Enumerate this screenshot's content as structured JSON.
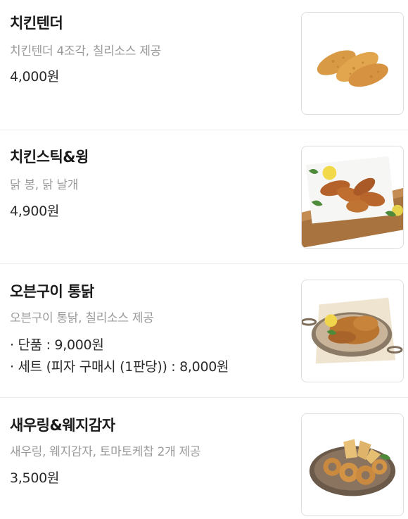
{
  "menu": {
    "items": [
      {
        "name": "치킨텐더",
        "description": "치킨텐더 4조각, 칠리소스 제공",
        "price": "4,000원",
        "image": "chicken-tenders-photo"
      },
      {
        "name": "치킨스틱&윙",
        "description": "닭 봉, 닭 날개",
        "price": "4,900원",
        "image": "chicken-sticks-wings-photo"
      },
      {
        "name": "오븐구이 통닭",
        "description": "오븐구이 통닭, 칠리소스 제공",
        "price_lines": [
          "· 단품 : 9,000원",
          "· 세트 (피자 구매시 (1판당)) : 8,000원"
        ],
        "image": "oven-roasted-chicken-photo"
      },
      {
        "name": "새우링&웨지감자",
        "description": "새우링, 웨지감자, 토마토케찹 2개 제공",
        "price": "3,500원",
        "image": "shrimp-rings-wedge-potatoes-photo"
      }
    ]
  }
}
